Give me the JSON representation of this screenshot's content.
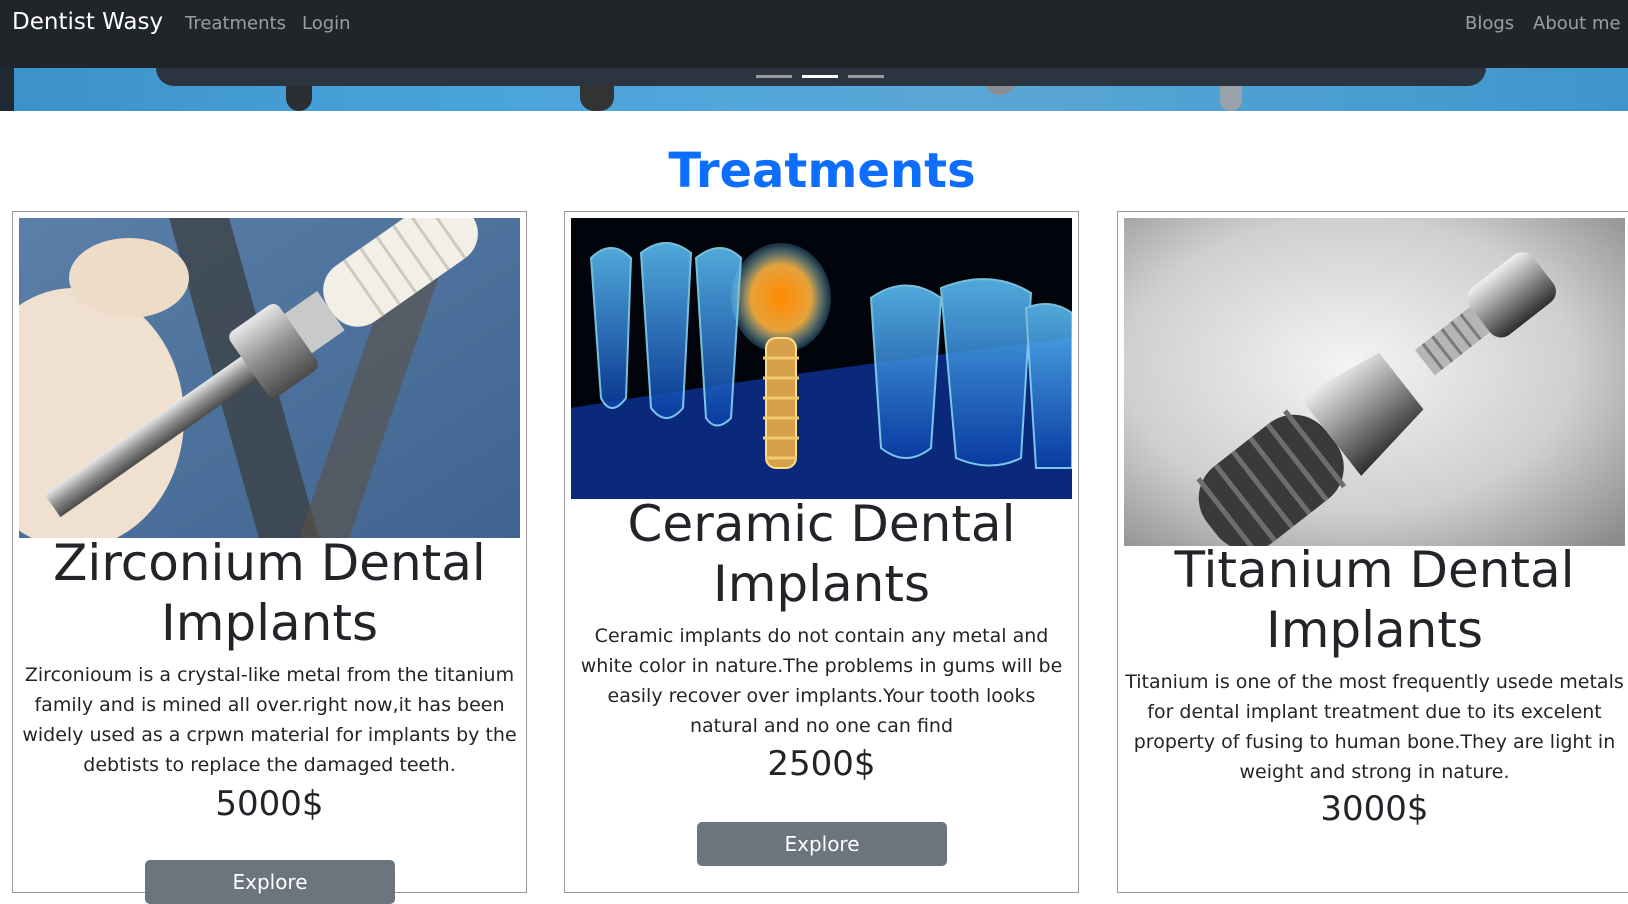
{
  "navbar": {
    "brand": "Dentist Wasy",
    "links": [
      "Treatments",
      "Login"
    ],
    "right_links": [
      "Blogs",
      "About me"
    ]
  },
  "section": {
    "title": "Treatments"
  },
  "cards": [
    {
      "title": "Zirconium Dental Implants",
      "text": "Zirconioum is a crystal-like metal from the titanium family and is mined all over.right now,it has been widely used as a crpwn material for implants by the debtists to replace the damaged teeth.",
      "price": "5000$",
      "button": "Explore"
    },
    {
      "title": "Ceramic Dental Implants",
      "text": "Ceramic implants do not contain any metal and white color in nature.The problems in gums will be easily recover over implants.Your tooth looks natural and no one can find",
      "price": "2500$",
      "button": "Explore"
    },
    {
      "title": "Titanium Dental Implants",
      "text": "Titanium is one of the most frequently usede metals for dental implant treatment due to its excelent property of fusing to human bone.They are light in weight and strong in nature.",
      "price": "3000$",
      "button": "Explore"
    }
  ],
  "colors": {
    "navbar": "#212529",
    "accent": "#0d6efd",
    "button": "#6c757d"
  }
}
